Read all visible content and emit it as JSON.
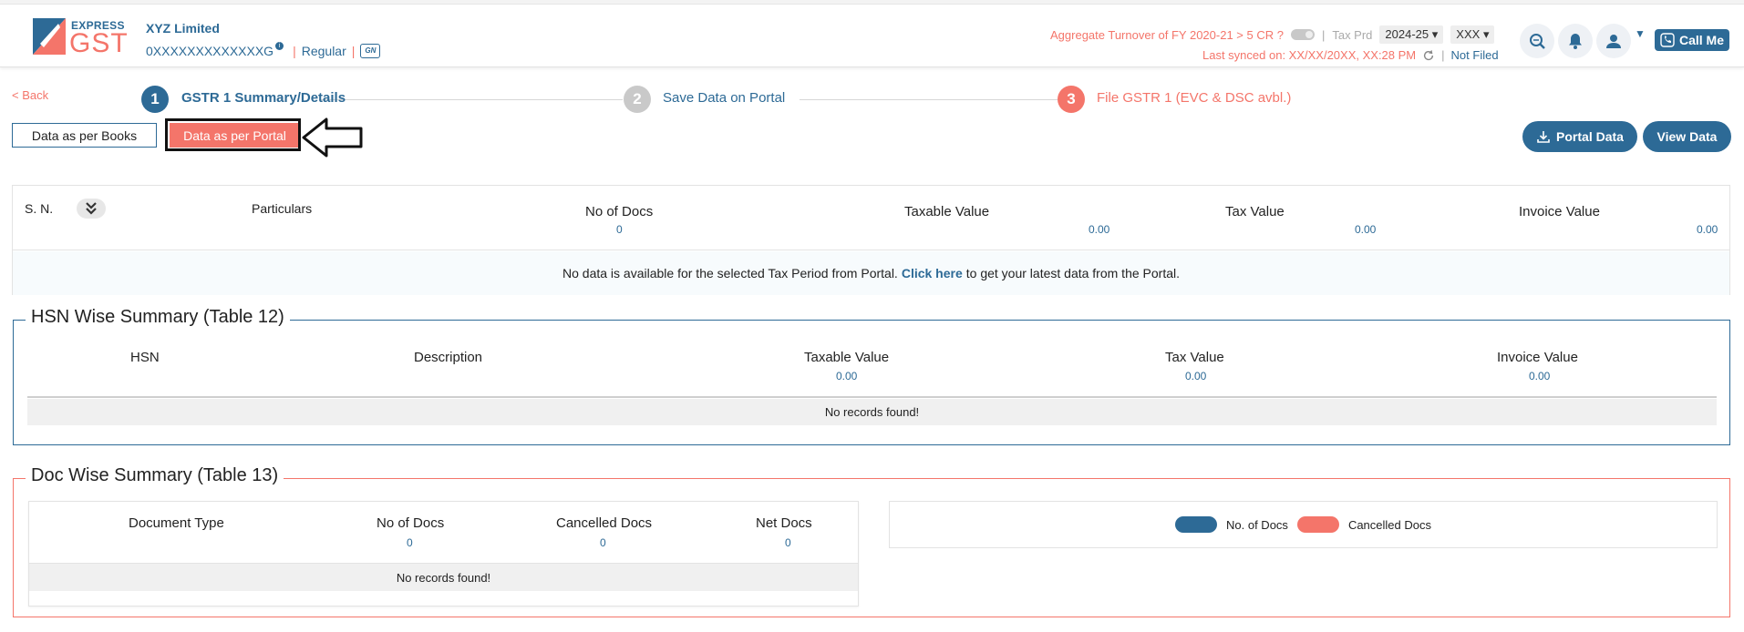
{
  "header": {
    "logo_express": "EXPRESS",
    "logo_gst": "GST",
    "company_name": "XYZ Limited",
    "gstin": "0XXXXXXXXXXXXXG",
    "info_badge": "i",
    "registration_type": "Regular",
    "gsn_badge": "GN",
    "turnover_label": "Aggregate Turnover of FY 2020-21 > 5 CR ?",
    "tax_period_label": "Tax Prd",
    "year_value": "2024-25",
    "period_value": "XXX",
    "last_synced": "Last synced on: XX/XX/20XX, XX:28 PM",
    "filing_status": "Not Filed",
    "call_me_label": "Call Me",
    "pipe": "|",
    "colors": {
      "brand_blue": "#2d6a96",
      "accent_salmon": "#f4756a"
    }
  },
  "nav": {
    "back_label": "< Back",
    "steps": [
      {
        "num": "1",
        "label": "GSTR 1 Summary/Details"
      },
      {
        "num": "2",
        "label": "Save Data on Portal"
      },
      {
        "num": "3",
        "label": "File GSTR 1 (EVC & DSC avbl.)"
      }
    ],
    "tabs": {
      "books": "Data as per Books",
      "portal": "Data as per Portal"
    },
    "portal_data_label": "Portal Data",
    "view_data_label": "View Data"
  },
  "summary": {
    "columns": {
      "sn": "S. N.",
      "particulars": "Particulars",
      "no_of_docs": "No of Docs",
      "taxable_value": "Taxable Value",
      "tax_value": "Tax Value",
      "invoice_value": "Invoice Value"
    },
    "totals": {
      "no_of_docs": "0",
      "taxable_value": "0.00",
      "tax_value": "0.00",
      "invoice_value": "0.00"
    },
    "empty_prefix": "No data is available for the selected Tax Period from Portal.",
    "empty_link": "Click here",
    "empty_suffix": "to get your latest data from the Portal."
  },
  "hsn": {
    "title": "HSN Wise Summary (Table 12)",
    "columns": {
      "hsn": "HSN",
      "description": "Description",
      "taxable_value": "Taxable Value",
      "tax_value": "Tax Value",
      "invoice_value": "Invoice Value"
    },
    "totals": {
      "taxable_value": "0.00",
      "tax_value": "0.00",
      "invoice_value": "0.00"
    },
    "empty": "No records found!"
  },
  "doc": {
    "title": "Doc Wise Summary (Table 13)",
    "columns": {
      "document_type": "Document Type",
      "no_of_docs": "No of Docs",
      "cancelled_docs": "Cancelled Docs",
      "net_docs": "Net Docs"
    },
    "totals": {
      "no_of_docs": "0",
      "cancelled_docs": "0",
      "net_docs": "0"
    },
    "empty": "No records found!",
    "legend": [
      {
        "name": "No. of Docs",
        "color": "#2d6a96"
      },
      {
        "name": "Cancelled Docs",
        "color": "#f4756a"
      }
    ]
  },
  "icons": [
    "logo-icon",
    "info-icon",
    "gsn-icon",
    "toggle-icon",
    "dropdown-icon",
    "refresh-icon",
    "search-doc-icon",
    "bell-icon",
    "user-icon",
    "chevron-down-icon",
    "phone-icon",
    "download-icon",
    "double-chevron-down-icon",
    "arrow-left-icon"
  ]
}
